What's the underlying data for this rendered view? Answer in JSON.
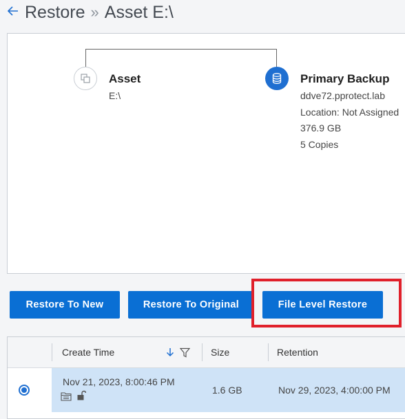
{
  "header": {
    "back_icon": "arrow-left-icon",
    "title_part1": "Restore",
    "separator": "»",
    "title_part2": "Asset E:\\"
  },
  "topology": {
    "asset": {
      "icon": "copy-icon",
      "title": "Asset",
      "name": "E:\\"
    },
    "primary_backup": {
      "icon": "database-icon",
      "title": "Primary Backup",
      "host": "ddve72.pprotect.lab",
      "location": "Location: Not Assigned",
      "size": "376.9 GB",
      "copies": "5 Copies"
    }
  },
  "actions": {
    "restore_to_new": "Restore To New",
    "restore_to_original": "Restore To Original",
    "file_level_restore": "File Level Restore"
  },
  "table": {
    "columns": {
      "create_time": "Create Time",
      "size": "Size",
      "retention": "Retention"
    },
    "sort_icon": "arrow-down-icon",
    "filter_icon": "filter-icon",
    "rows": [
      {
        "selected": true,
        "create_time": "Nov 21, 2023, 8:00:46 PM",
        "icons": [
          "folder-icon",
          "unlock-icon"
        ],
        "size": "1.6 GB",
        "retention": "Nov 29, 2023, 4:00:00 PM"
      }
    ]
  },
  "colors": {
    "accent": "#0a6fd4",
    "highlight": "#e0202b",
    "selected_row": "#cfe3f7"
  }
}
